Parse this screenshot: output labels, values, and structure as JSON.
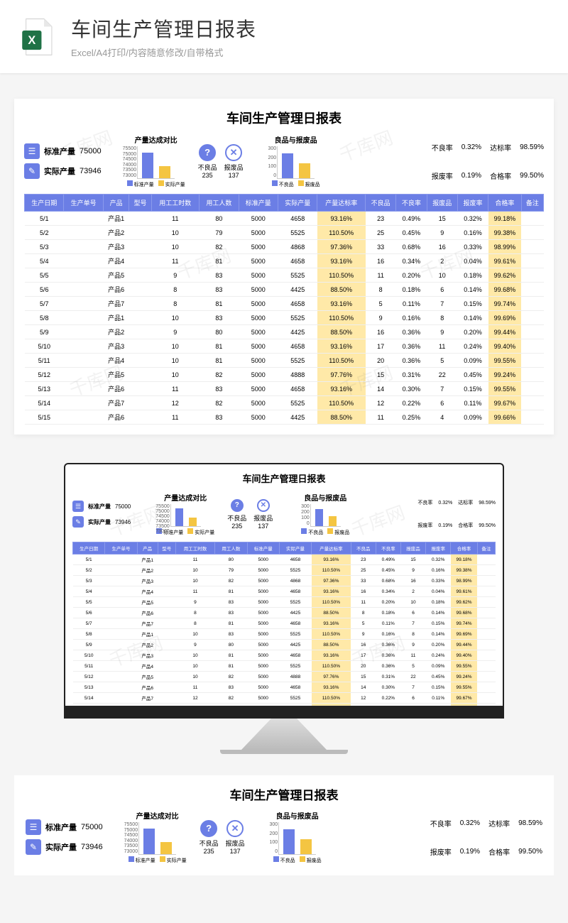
{
  "header": {
    "title": "车间生产管理日报表",
    "subtitle": "Excel/A4打印/内容随意修改/自带格式"
  },
  "report": {
    "title": "车间生产管理日报表",
    "kpi": {
      "std_label": "标准产量",
      "std_value": "75000",
      "act_label": "实际产量",
      "act_value": "73946"
    },
    "chart1": {
      "title": "产量达成对比",
      "ticks": [
        "75500",
        "75000",
        "74500",
        "74000",
        "73500",
        "73000"
      ],
      "legend": [
        "标准产量",
        "实际产量"
      ]
    },
    "stat_icons": {
      "defect_label": "不良品",
      "defect_value": "235",
      "scrap_label": "报废品",
      "scrap_value": "137"
    },
    "chart2": {
      "title": "良品与报废品",
      "ticks": [
        "300",
        "200",
        "100",
        "0"
      ],
      "legend": [
        "不良品",
        "报废品"
      ]
    },
    "rates": {
      "defect_rate_label": "不良率",
      "defect_rate": "0.32%",
      "target_rate_label": "达标率",
      "target_rate": "98.59%",
      "scrap_rate_label": "报废率",
      "scrap_rate": "0.19%",
      "pass_rate_label": "合格率",
      "pass_rate": "99.50%"
    },
    "columns": [
      "生产日期",
      "生产单号",
      "产品",
      "型号",
      "用工工时数",
      "用工人数",
      "标准产量",
      "实际产量",
      "产量达标率",
      "不良品",
      "不良率",
      "报废品",
      "报废率",
      "合格率",
      "备注"
    ],
    "rows": [
      [
        "5/1",
        "",
        "产品1",
        "",
        "11",
        "80",
        "5000",
        "4658",
        "93.16%",
        "23",
        "0.49%",
        "15",
        "0.32%",
        "99.18%",
        ""
      ],
      [
        "5/2",
        "",
        "产品2",
        "",
        "10",
        "79",
        "5000",
        "5525",
        "110.50%",
        "25",
        "0.45%",
        "9",
        "0.16%",
        "99.38%",
        ""
      ],
      [
        "5/3",
        "",
        "产品3",
        "",
        "10",
        "82",
        "5000",
        "4868",
        "97.36%",
        "33",
        "0.68%",
        "16",
        "0.33%",
        "98.99%",
        ""
      ],
      [
        "5/4",
        "",
        "产品4",
        "",
        "11",
        "81",
        "5000",
        "4658",
        "93.16%",
        "16",
        "0.34%",
        "2",
        "0.04%",
        "99.61%",
        ""
      ],
      [
        "5/5",
        "",
        "产品5",
        "",
        "9",
        "83",
        "5000",
        "5525",
        "110.50%",
        "11",
        "0.20%",
        "10",
        "0.18%",
        "99.62%",
        ""
      ],
      [
        "5/6",
        "",
        "产品6",
        "",
        "8",
        "83",
        "5000",
        "4425",
        "88.50%",
        "8",
        "0.18%",
        "6",
        "0.14%",
        "99.68%",
        ""
      ],
      [
        "5/7",
        "",
        "产品7",
        "",
        "8",
        "81",
        "5000",
        "4658",
        "93.16%",
        "5",
        "0.11%",
        "7",
        "0.15%",
        "99.74%",
        ""
      ],
      [
        "5/8",
        "",
        "产品1",
        "",
        "10",
        "83",
        "5000",
        "5525",
        "110.50%",
        "9",
        "0.16%",
        "8",
        "0.14%",
        "99.69%",
        ""
      ],
      [
        "5/9",
        "",
        "产品2",
        "",
        "9",
        "80",
        "5000",
        "4425",
        "88.50%",
        "16",
        "0.36%",
        "9",
        "0.20%",
        "99.44%",
        ""
      ],
      [
        "5/10",
        "",
        "产品3",
        "",
        "10",
        "81",
        "5000",
        "4658",
        "93.16%",
        "17",
        "0.36%",
        "11",
        "0.24%",
        "99.40%",
        ""
      ],
      [
        "5/11",
        "",
        "产品4",
        "",
        "10",
        "81",
        "5000",
        "5525",
        "110.50%",
        "20",
        "0.36%",
        "5",
        "0.09%",
        "99.55%",
        ""
      ],
      [
        "5/12",
        "",
        "产品5",
        "",
        "10",
        "82",
        "5000",
        "4888",
        "97.76%",
        "15",
        "0.31%",
        "22",
        "0.45%",
        "99.24%",
        ""
      ],
      [
        "5/13",
        "",
        "产品6",
        "",
        "11",
        "83",
        "5000",
        "4658",
        "93.16%",
        "14",
        "0.30%",
        "7",
        "0.15%",
        "99.55%",
        ""
      ],
      [
        "5/14",
        "",
        "产品7",
        "",
        "12",
        "82",
        "5000",
        "5525",
        "110.50%",
        "12",
        "0.22%",
        "6",
        "0.11%",
        "99.67%",
        ""
      ],
      [
        "5/15",
        "",
        "产品6",
        "",
        "11",
        "83",
        "5000",
        "4425",
        "88.50%",
        "11",
        "0.25%",
        "4",
        "0.09%",
        "99.66%",
        ""
      ]
    ]
  },
  "chart_data": [
    {
      "type": "bar",
      "title": "产量达成对比",
      "categories": [
        "标准产量",
        "实际产量"
      ],
      "values": [
        75000,
        73946
      ],
      "ylim": [
        73000,
        75500
      ]
    },
    {
      "type": "bar",
      "title": "良品与报废品",
      "categories": [
        "不良品",
        "报废品"
      ],
      "values": [
        235,
        137
      ],
      "ylim": [
        0,
        300
      ]
    }
  ],
  "watermark_text": "千库网"
}
